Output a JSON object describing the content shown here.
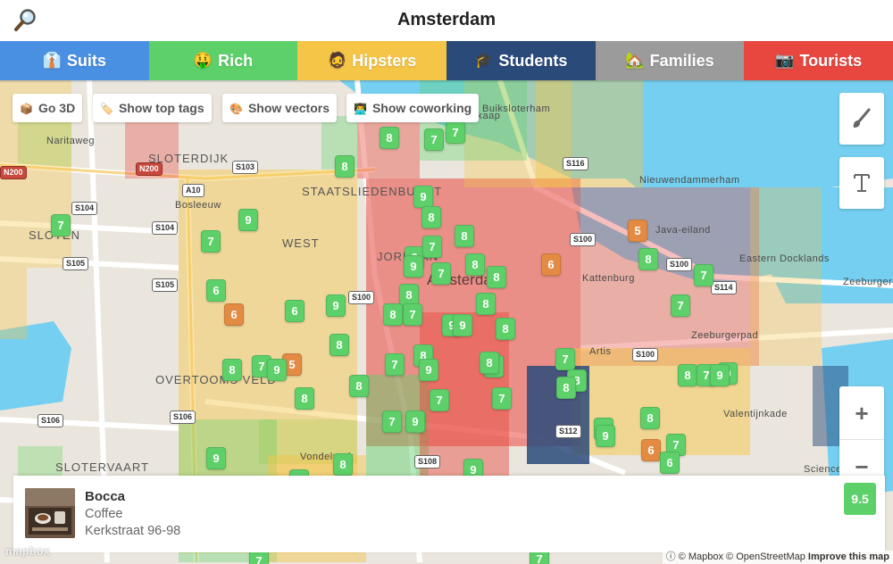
{
  "header": {
    "title": "Amsterdam",
    "search_icon": "magnifier-icon"
  },
  "tabs": [
    {
      "emoji": "👔",
      "label": "Suits",
      "color": "#4a90e2"
    },
    {
      "emoji": "🤑",
      "label": "Rich",
      "color": "#5ed06a"
    },
    {
      "emoji": "🧔",
      "label": "Hipsters",
      "color": "#f5c547"
    },
    {
      "emoji": "🎓",
      "label": "Students",
      "color": "#2a4a7a"
    },
    {
      "emoji": "🏡",
      "label": "Families",
      "color": "#9b9b9b"
    },
    {
      "emoji": "📷",
      "label": "Tourists",
      "color": "#e8473f"
    }
  ],
  "map_buttons": [
    {
      "emoji": "📦",
      "label": "Go 3D"
    },
    {
      "emoji": "🏷️",
      "label": "Show top tags"
    },
    {
      "emoji": "🎨",
      "label": "Show vectors"
    },
    {
      "emoji": "👨‍💻",
      "label": "Show coworking"
    }
  ],
  "controls": {
    "brush": "paintbrush-icon",
    "text": "text-icon",
    "zoom_in": "+",
    "zoom_out": "−"
  },
  "map_labels": {
    "city": "Amsterdam",
    "places": [
      "SLOTERDIJK",
      "STAATSLIEDENBUURT",
      "WEST",
      "JORDAAN",
      "OVERTOOMS VELD",
      "SLOTERVAART",
      "Naritaweg",
      "Bosleeuw",
      "SLOTEN",
      "Buiksloterham",
      "Nieuwendammerham",
      "Java-eiland",
      "Eastern Docklands",
      "Zeeburgereiland",
      "Kattenburg",
      "Zeeburgerpad",
      "Artis",
      "Valentijnkade",
      "Science Park",
      "Vondelpark",
      "Noordkaap"
    ],
    "roads": [
      "S103",
      "S104",
      "S104",
      "S105",
      "S105",
      "S100",
      "S100",
      "S100",
      "S114",
      "S116",
      "S100",
      "S106",
      "S108",
      "S106",
      "S112",
      "A10",
      "N200",
      "N200"
    ]
  },
  "markers": [
    {
      "v": "8",
      "c": "#5ed06a"
    },
    {
      "v": "7",
      "c": "#5ed06a"
    },
    {
      "v": "7",
      "c": "#5ed06a"
    },
    {
      "v": "8",
      "c": "#5ed06a"
    },
    {
      "v": "9",
      "c": "#5ed06a"
    },
    {
      "v": "8",
      "c": "#5ed06a"
    },
    {
      "v": "7",
      "c": "#5ed06a"
    },
    {
      "v": "8",
      "c": "#5ed06a"
    },
    {
      "v": "6",
      "c": "#5ed06a"
    },
    {
      "v": "7",
      "c": "#5ed06a"
    },
    {
      "v": "7",
      "c": "#5ed06a"
    },
    {
      "v": "9",
      "c": "#5ed06a"
    },
    {
      "v": "9",
      "c": "#5ed06a"
    },
    {
      "v": "7",
      "c": "#5ed06a"
    },
    {
      "v": "8",
      "c": "#5ed06a"
    },
    {
      "v": "6",
      "c": "#5ed06a"
    },
    {
      "v": "6",
      "c": "#e38b43"
    },
    {
      "v": "6",
      "c": "#5ed06a"
    },
    {
      "v": "9",
      "c": "#5ed06a"
    },
    {
      "v": "8",
      "c": "#5ed06a"
    },
    {
      "v": "7",
      "c": "#5ed06a"
    },
    {
      "v": "8",
      "c": "#5ed06a"
    },
    {
      "v": "8",
      "c": "#5ed06a"
    },
    {
      "v": "9",
      "c": "#5ed06a"
    },
    {
      "v": "9",
      "c": "#5ed06a"
    },
    {
      "v": "8",
      "c": "#5ed06a"
    },
    {
      "v": "6",
      "c": "#e38b43"
    },
    {
      "v": "5",
      "c": "#e38b43"
    },
    {
      "v": "8",
      "c": "#5ed06a"
    },
    {
      "v": "8",
      "c": "#5ed06a"
    },
    {
      "v": "7",
      "c": "#5ed06a"
    },
    {
      "v": "7",
      "c": "#5ed06a"
    },
    {
      "v": "8",
      "c": "#5ed06a"
    },
    {
      "v": "8",
      "c": "#5ed06a"
    },
    {
      "v": "7",
      "c": "#5ed06a"
    },
    {
      "v": "5",
      "c": "#e38b43"
    },
    {
      "v": "9",
      "c": "#5ed06a"
    },
    {
      "v": "8",
      "c": "#5ed06a"
    },
    {
      "v": "8",
      "c": "#5ed06a"
    },
    {
      "v": "7",
      "c": "#5ed06a"
    },
    {
      "v": "8",
      "c": "#5ed06a"
    },
    {
      "v": "9",
      "c": "#5ed06a"
    },
    {
      "v": "9",
      "c": "#5ed06a"
    },
    {
      "v": "8",
      "c": "#5ed06a"
    },
    {
      "v": "7",
      "c": "#5ed06a"
    },
    {
      "v": "8",
      "c": "#5ed06a"
    },
    {
      "v": "8",
      "c": "#5ed06a"
    },
    {
      "v": "8",
      "c": "#5ed06a"
    },
    {
      "v": "7",
      "c": "#5ed06a"
    },
    {
      "v": "9",
      "c": "#5ed06a"
    },
    {
      "v": "9",
      "c": "#5ed06a"
    },
    {
      "v": "7",
      "c": "#5ed06a"
    },
    {
      "v": "7",
      "c": "#5ed06a"
    },
    {
      "v": "9",
      "c": "#5ed06a"
    },
    {
      "v": "7",
      "c": "#5ed06a"
    },
    {
      "v": "8",
      "c": "#5ed06a"
    },
    {
      "v": "7",
      "c": "#5ed06a"
    },
    {
      "v": "9",
      "c": "#5ed06a"
    },
    {
      "v": "7",
      "c": "#5ed06a"
    },
    {
      "v": "6",
      "c": "#e38b43"
    },
    {
      "v": "6",
      "c": "#5ed06a"
    },
    {
      "v": "9",
      "c": "#5ed06a"
    },
    {
      "v": "7",
      "c": "#5ed06a"
    },
    {
      "v": "8",
      "c": "#5ed06a"
    },
    {
      "v": "9",
      "c": "#5ed06a"
    },
    {
      "v": "7",
      "c": "#5ed06a"
    },
    {
      "v": "7",
      "c": "#5ed06a"
    }
  ],
  "place_card": {
    "name": "Bocca",
    "type": "Coffee",
    "address": "Kerkstraat 96-98",
    "score": "9.5",
    "score_color": "#5ed06a"
  },
  "attribution": {
    "mapbox": "© Mapbox",
    "osm": "© OpenStreetMap",
    "improve": "Improve this map",
    "logo": "mapbox"
  }
}
